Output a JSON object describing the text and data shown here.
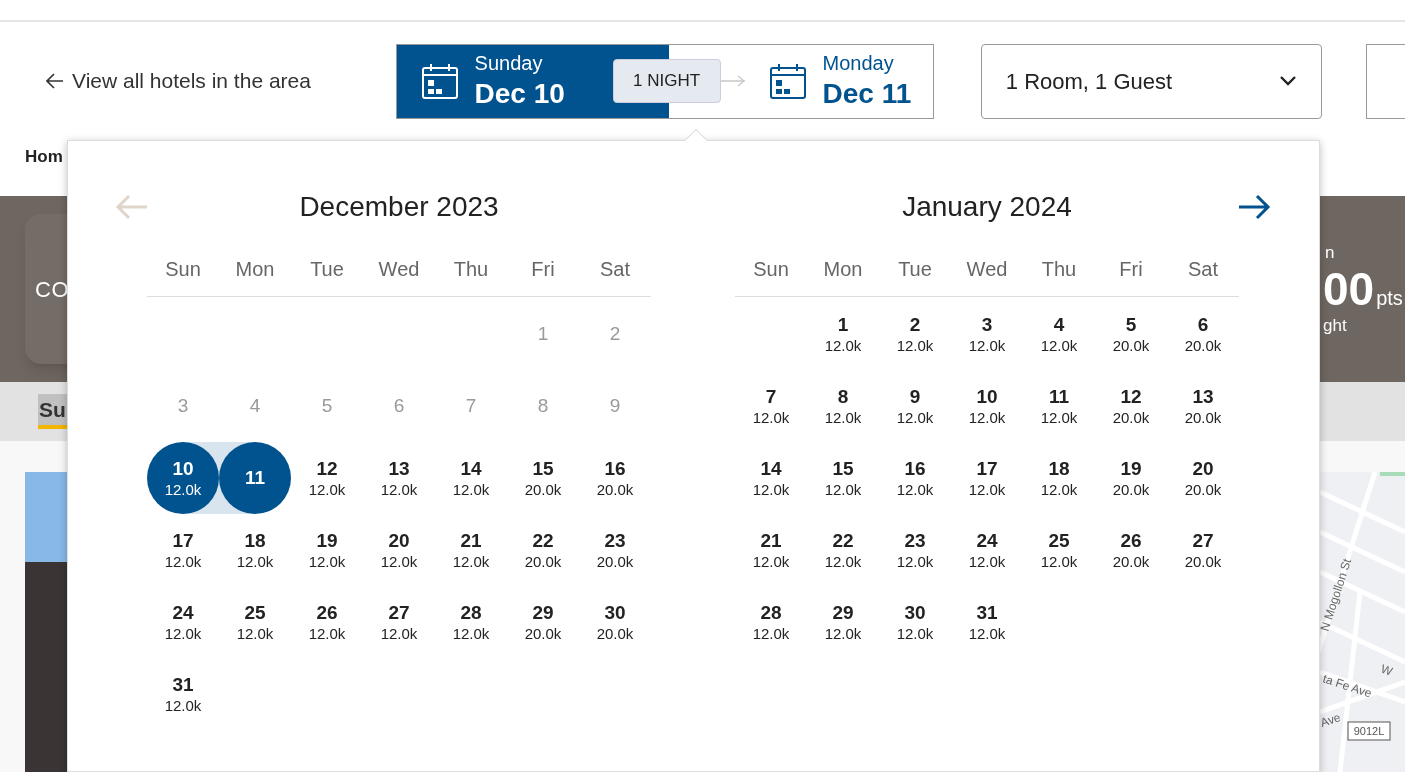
{
  "header": {
    "back_link": "View all hotels in the area",
    "check_in": {
      "weekday": "Sunday",
      "date": "Dec 10",
      "selected": true
    },
    "nights": "1 NIGHT",
    "check_out": {
      "weekday": "Monday",
      "date": "Dec 11",
      "selected": false
    },
    "rooms": "1 Room, 1 Guest"
  },
  "breadcrumb": "Hom",
  "hero": {
    "card_text": "CO",
    "label": "n",
    "points": "00",
    "unit": "pts",
    "note": "ght"
  },
  "tab": "Su",
  "map": {
    "labels": [
      "N Mogollon St",
      "W",
      "ta Fe Ave",
      "Ave"
    ],
    "route_sign": "9012L"
  },
  "calendar": {
    "prev_disabled": true,
    "next_disabled": false,
    "months": [
      {
        "title": "December 2023",
        "weekdays": [
          "Sun",
          "Mon",
          "Tue",
          "Wed",
          "Thu",
          "Fri",
          "Sat"
        ],
        "days": [
          {
            "kind": "blank"
          },
          {
            "kind": "blank"
          },
          {
            "kind": "blank"
          },
          {
            "kind": "blank"
          },
          {
            "kind": "blank"
          },
          {
            "kind": "day",
            "day": "1",
            "disabled": true,
            "selected": false
          },
          {
            "kind": "day",
            "day": "2",
            "disabled": true,
            "selected": false
          },
          {
            "kind": "day",
            "day": "3",
            "disabled": true,
            "selected": false
          },
          {
            "kind": "day",
            "day": "4",
            "disabled": true,
            "selected": false
          },
          {
            "kind": "day",
            "day": "5",
            "disabled": true,
            "selected": false
          },
          {
            "kind": "day",
            "day": "6",
            "disabled": true,
            "selected": false
          },
          {
            "kind": "day",
            "day": "7",
            "disabled": true,
            "selected": false
          },
          {
            "kind": "day",
            "day": "8",
            "disabled": true,
            "selected": false
          },
          {
            "kind": "day",
            "day": "9",
            "disabled": true,
            "selected": false
          },
          {
            "kind": "day",
            "day": "10",
            "price": "12.0k",
            "disabled": false,
            "selected": true
          },
          {
            "kind": "day",
            "day": "11",
            "disabled": false,
            "selected": true
          },
          {
            "kind": "day",
            "day": "12",
            "price": "12.0k",
            "disabled": false,
            "selected": false
          },
          {
            "kind": "day",
            "day": "13",
            "price": "12.0k",
            "disabled": false,
            "selected": false
          },
          {
            "kind": "day",
            "day": "14",
            "price": "12.0k",
            "disabled": false,
            "selected": false
          },
          {
            "kind": "day",
            "day": "15",
            "price": "20.0k",
            "disabled": false,
            "selected": false
          },
          {
            "kind": "day",
            "day": "16",
            "price": "20.0k",
            "disabled": false,
            "selected": false
          },
          {
            "kind": "day",
            "day": "17",
            "price": "12.0k",
            "disabled": false,
            "selected": false
          },
          {
            "kind": "day",
            "day": "18",
            "price": "12.0k",
            "disabled": false,
            "selected": false
          },
          {
            "kind": "day",
            "day": "19",
            "price": "12.0k",
            "disabled": false,
            "selected": false
          },
          {
            "kind": "day",
            "day": "20",
            "price": "12.0k",
            "disabled": false,
            "selected": false
          },
          {
            "kind": "day",
            "day": "21",
            "price": "12.0k",
            "disabled": false,
            "selected": false
          },
          {
            "kind": "day",
            "day": "22",
            "price": "20.0k",
            "disabled": false,
            "selected": false
          },
          {
            "kind": "day",
            "day": "23",
            "price": "20.0k",
            "disabled": false,
            "selected": false
          },
          {
            "kind": "day",
            "day": "24",
            "price": "12.0k",
            "disabled": false,
            "selected": false
          },
          {
            "kind": "day",
            "day": "25",
            "price": "12.0k",
            "disabled": false,
            "selected": false
          },
          {
            "kind": "day",
            "day": "26",
            "price": "12.0k",
            "disabled": false,
            "selected": false
          },
          {
            "kind": "day",
            "day": "27",
            "price": "12.0k",
            "disabled": false,
            "selected": false
          },
          {
            "kind": "day",
            "day": "28",
            "price": "12.0k",
            "disabled": false,
            "selected": false
          },
          {
            "kind": "day",
            "day": "29",
            "price": "20.0k",
            "disabled": false,
            "selected": false
          },
          {
            "kind": "day",
            "day": "30",
            "price": "20.0k",
            "disabled": false,
            "selected": false
          },
          {
            "kind": "day",
            "day": "31",
            "price": "12.0k",
            "disabled": false,
            "selected": false
          }
        ]
      },
      {
        "title": "January 2024",
        "weekdays": [
          "Sun",
          "Mon",
          "Tue",
          "Wed",
          "Thu",
          "Fri",
          "Sat"
        ],
        "days": [
          {
            "kind": "blank"
          },
          {
            "kind": "day",
            "day": "1",
            "price": "12.0k",
            "disabled": false,
            "selected": false
          },
          {
            "kind": "day",
            "day": "2",
            "price": "12.0k",
            "disabled": false,
            "selected": false
          },
          {
            "kind": "day",
            "day": "3",
            "price": "12.0k",
            "disabled": false,
            "selected": false
          },
          {
            "kind": "day",
            "day": "4",
            "price": "12.0k",
            "disabled": false,
            "selected": false
          },
          {
            "kind": "day",
            "day": "5",
            "price": "20.0k",
            "disabled": false,
            "selected": false
          },
          {
            "kind": "day",
            "day": "6",
            "price": "20.0k",
            "disabled": false,
            "selected": false
          },
          {
            "kind": "day",
            "day": "7",
            "price": "12.0k",
            "disabled": false,
            "selected": false
          },
          {
            "kind": "day",
            "day": "8",
            "price": "12.0k",
            "disabled": false,
            "selected": false
          },
          {
            "kind": "day",
            "day": "9",
            "price": "12.0k",
            "disabled": false,
            "selected": false
          },
          {
            "kind": "day",
            "day": "10",
            "price": "12.0k",
            "disabled": false,
            "selected": false
          },
          {
            "kind": "day",
            "day": "11",
            "price": "12.0k",
            "disabled": false,
            "selected": false
          },
          {
            "kind": "day",
            "day": "12",
            "price": "20.0k",
            "disabled": false,
            "selected": false
          },
          {
            "kind": "day",
            "day": "13",
            "price": "20.0k",
            "disabled": false,
            "selected": false
          },
          {
            "kind": "day",
            "day": "14",
            "price": "12.0k",
            "disabled": false,
            "selected": false
          },
          {
            "kind": "day",
            "day": "15",
            "price": "12.0k",
            "disabled": false,
            "selected": false
          },
          {
            "kind": "day",
            "day": "16",
            "price": "12.0k",
            "disabled": false,
            "selected": false
          },
          {
            "kind": "day",
            "day": "17",
            "price": "12.0k",
            "disabled": false,
            "selected": false
          },
          {
            "kind": "day",
            "day": "18",
            "price": "12.0k",
            "disabled": false,
            "selected": false
          },
          {
            "kind": "day",
            "day": "19",
            "price": "20.0k",
            "disabled": false,
            "selected": false
          },
          {
            "kind": "day",
            "day": "20",
            "price": "20.0k",
            "disabled": false,
            "selected": false
          },
          {
            "kind": "day",
            "day": "21",
            "price": "12.0k",
            "disabled": false,
            "selected": false
          },
          {
            "kind": "day",
            "day": "22",
            "price": "12.0k",
            "disabled": false,
            "selected": false
          },
          {
            "kind": "day",
            "day": "23",
            "price": "12.0k",
            "disabled": false,
            "selected": false
          },
          {
            "kind": "day",
            "day": "24",
            "price": "12.0k",
            "disabled": false,
            "selected": false
          },
          {
            "kind": "day",
            "day": "25",
            "price": "12.0k",
            "disabled": false,
            "selected": false
          },
          {
            "kind": "day",
            "day": "26",
            "price": "20.0k",
            "disabled": false,
            "selected": false
          },
          {
            "kind": "day",
            "day": "27",
            "price": "20.0k",
            "disabled": false,
            "selected": false
          },
          {
            "kind": "day",
            "day": "28",
            "price": "12.0k",
            "disabled": false,
            "selected": false
          },
          {
            "kind": "day",
            "day": "29",
            "price": "12.0k",
            "disabled": false,
            "selected": false
          },
          {
            "kind": "day",
            "day": "30",
            "price": "12.0k",
            "disabled": false,
            "selected": false
          },
          {
            "kind": "day",
            "day": "31",
            "price": "12.0k",
            "disabled": false,
            "selected": false
          }
        ]
      }
    ]
  }
}
